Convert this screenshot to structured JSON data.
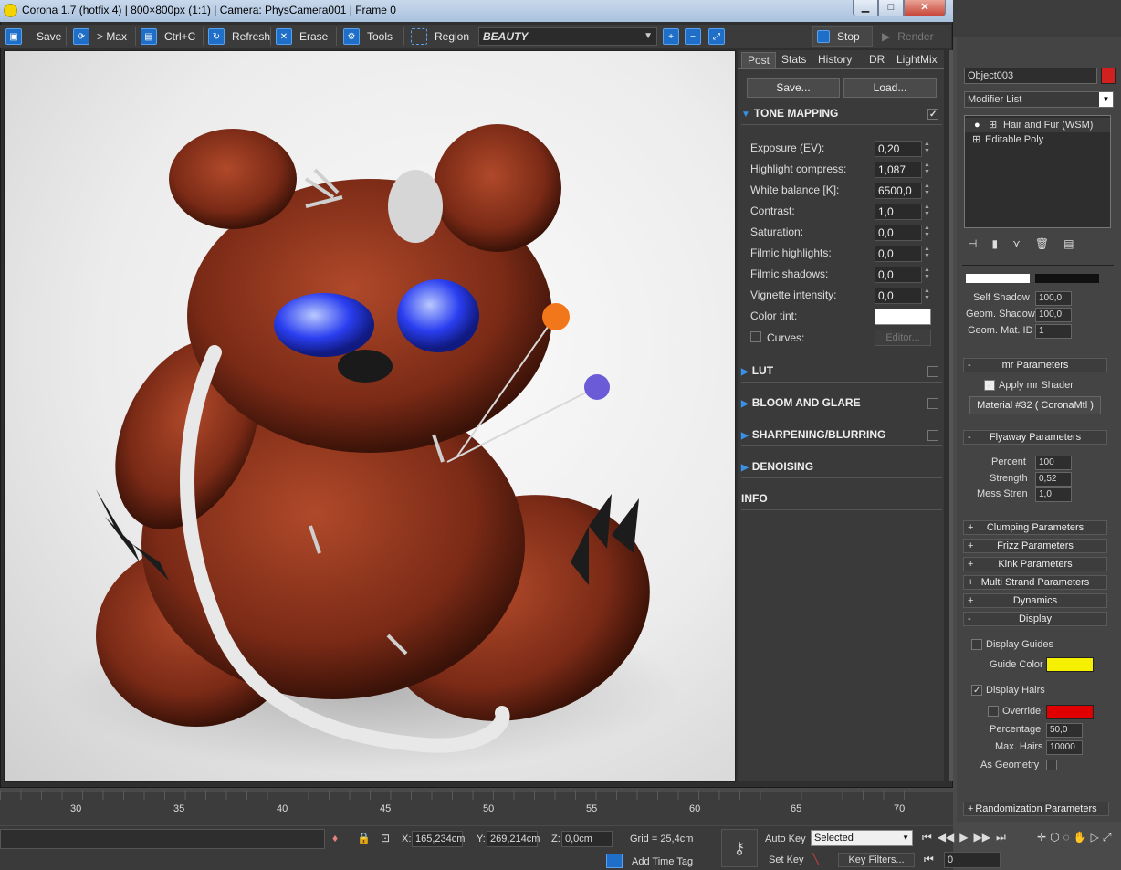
{
  "window": {
    "title": "Corona 1.7 (hotfix 4) | 800×800px (1:1) | Camera: PhysCamera001 | Frame 0",
    "minimize": "▁",
    "maximize": "□",
    "close": "✕"
  },
  "toolbar": {
    "save": "Save",
    "to_max": "> Max",
    "ctrl_c": "Ctrl+C",
    "refresh": "Refresh",
    "erase": "Erase",
    "tools": "Tools",
    "region": "Region",
    "channel": "BEAUTY",
    "stop": "Stop",
    "render": "Render"
  },
  "post_panel": {
    "tabs": [
      "Post",
      "Stats",
      "History",
      "DR",
      "LightMix"
    ],
    "save_button": "Save...",
    "load_button": "Load...",
    "tone_mapping": {
      "title": "TONE MAPPING",
      "params": [
        {
          "label": "Exposure (EV):",
          "value": "0,20"
        },
        {
          "label": "Highlight compress:",
          "value": "1,087"
        },
        {
          "label": "White balance [K]:",
          "value": "6500,0"
        },
        {
          "label": "Contrast:",
          "value": "1,0"
        },
        {
          "label": "Saturation:",
          "value": "0,0"
        },
        {
          "label": "Filmic highlights:",
          "value": "0,0"
        },
        {
          "label": "Filmic shadows:",
          "value": "0,0"
        },
        {
          "label": "Vignette intensity:",
          "value": "0,0"
        }
      ],
      "color_tint_label": "Color tint:",
      "curves_label": "Curves:",
      "editor_button": "Editor..."
    },
    "sections": [
      "LUT",
      "BLOOM AND GLARE",
      "SHARPENING/BLURRING",
      "DENOISING"
    ],
    "info": "INFO"
  },
  "timeline": {
    "ticks": [
      "30",
      "35",
      "40",
      "45",
      "50",
      "55",
      "60",
      "65",
      "70"
    ]
  },
  "status": {
    "x_label": "X:",
    "x_value": "165,234cm",
    "y_label": "Y:",
    "y_value": "269,214cm",
    "z_label": "Z:",
    "z_value": "0,0cm",
    "grid": "Grid = 25,4cm",
    "add_time_tag": "Add Time Tag",
    "auto_key": "Auto Key",
    "set_key": "Set Key",
    "selected": "Selected",
    "key_filters": "Key Filters...",
    "frame": "0"
  },
  "command_panel": {
    "object_name": "Object003",
    "modifier_list": "Modifier List",
    "stack": [
      "Hair and Fur (WSM)",
      "Editable Poly"
    ],
    "self_shadow_label": "Self Shadow",
    "self_shadow": "100,0",
    "geom_shadow_label": "Geom. Shadow",
    "geom_shadow": "100,0",
    "geom_mat_id_label": "Geom. Mat. ID",
    "geom_mat_id": "1",
    "mr_parameters": "mr Parameters",
    "apply_mr_shader": "Apply mr Shader",
    "material_button": "Material #32  ( CoronaMtl )",
    "flyaway_parameters": "Flyaway Parameters",
    "percent_label": "Percent",
    "percent": "100",
    "strength_label": "Strength",
    "strength": "0,52",
    "mess_stren_label": "Mess Stren",
    "mess_stren": "1,0",
    "rollouts": [
      "Clumping Parameters",
      "Frizz Parameters",
      "Kink Parameters",
      "Multi Strand Parameters",
      "Dynamics"
    ],
    "display": "Display",
    "display_guides": "Display Guides",
    "guide_color": "Guide Color",
    "display_hairs": "Display Hairs",
    "override": "Override:",
    "percentage_label": "Percentage",
    "percentage": "50,0",
    "max_hairs_label": "Max. Hairs",
    "max_hairs": "10000",
    "as_geometry": "As Geometry",
    "randomization": "Randomization Parameters"
  },
  "colors": {
    "guide_color": "#f5f000",
    "override_color": "#e00000",
    "object_color": "#d02020",
    "accent": "#1f6fc8"
  }
}
